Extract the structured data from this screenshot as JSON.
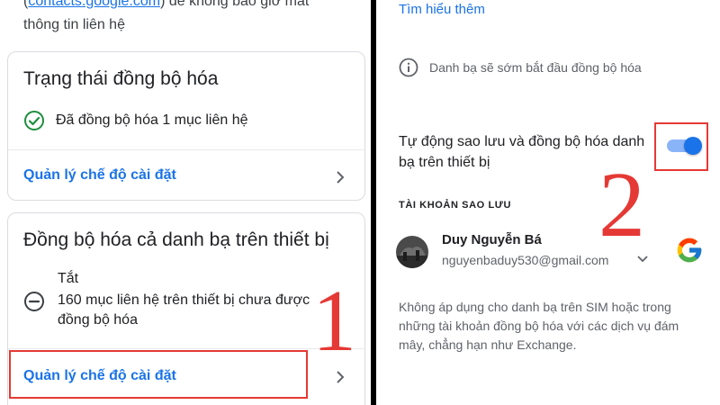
{
  "left": {
    "top_text": {
      "link": "contacts.google.com",
      "paren_open": "(",
      "after_link": ") để không bao giờ mất",
      "line2": "thông tin liên hệ"
    },
    "sync_status_card": {
      "title": "Trạng thái đồng bộ hóa",
      "status": "Đã đồng bộ hóa 1 mục liên hệ",
      "manage_label": "Quản lý chế độ cài đặt"
    },
    "device_sync_card": {
      "title": "Đồng bộ hóa cả danh bạ trên thiết bị",
      "state": "Tắt",
      "description": "160 mục liên hệ trên thiết bị chưa được đồng bộ hóa",
      "manage_label": "Quản lý chế độ cài đặt"
    },
    "step_number": "1"
  },
  "right": {
    "learn_more": "Tìm hiểu thêm",
    "info_text": "Danh bạ sẽ sớm bắt đầu đồng bộ hóa",
    "toggle_label": "Tự động sao lưu và đồng bộ hóa danh bạ trên thiết bị",
    "toggle_on": true,
    "section_header": "TÀI KHOẢN SAO LƯU",
    "account": {
      "name": "Duy Nguyễn Bá",
      "email": "nguyenbaduy530@gmail.com"
    },
    "note": "Không áp dụng cho danh bạ trên SIM hoặc trong những tài khoản đồng bộ hóa với các dịch vụ đám mây, chẳng hạn như Exchange.",
    "step_number": "2"
  },
  "colors": {
    "accent": "#1a73e8",
    "success": "#1e8e3e",
    "annotation": "#e53935"
  },
  "icons": [
    "check-circle-icon",
    "minus-circle-icon",
    "chevron-right-icon",
    "info-icon",
    "chevron-down-icon",
    "google-logo-icon"
  ]
}
